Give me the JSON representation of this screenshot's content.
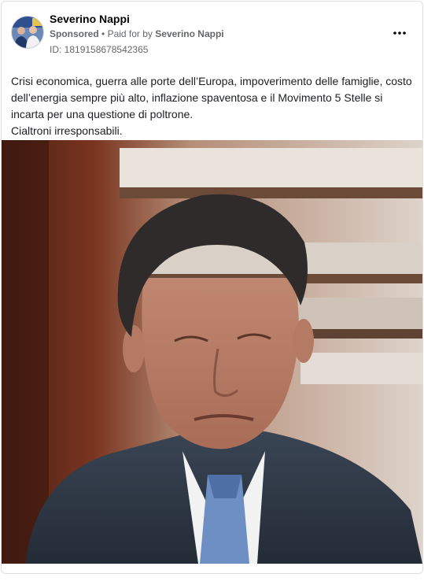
{
  "post": {
    "author": "Severino Nappi",
    "sponsored": "Sponsored",
    "separator": "•",
    "paid_prefix": "Paid for by",
    "paid_by": "Severino Nappi",
    "ad_id": "ID: 1819158678542365",
    "more_icon": "more-horizontal-icon",
    "text_line_1": "Crisi economica, guerra alle porte dell’Europa, impoverimento delle famiglie, costo dell’energia sempre più alto, inflazione spaventosa e il Movimento 5 Stelle si incarta per una questione di poltrone.",
    "text_line_2": "Cialtroni irresponsabili."
  },
  "colors": {
    "text_primary": "#050505",
    "text_secondary": "#65676b",
    "border": "#dddfe2"
  }
}
